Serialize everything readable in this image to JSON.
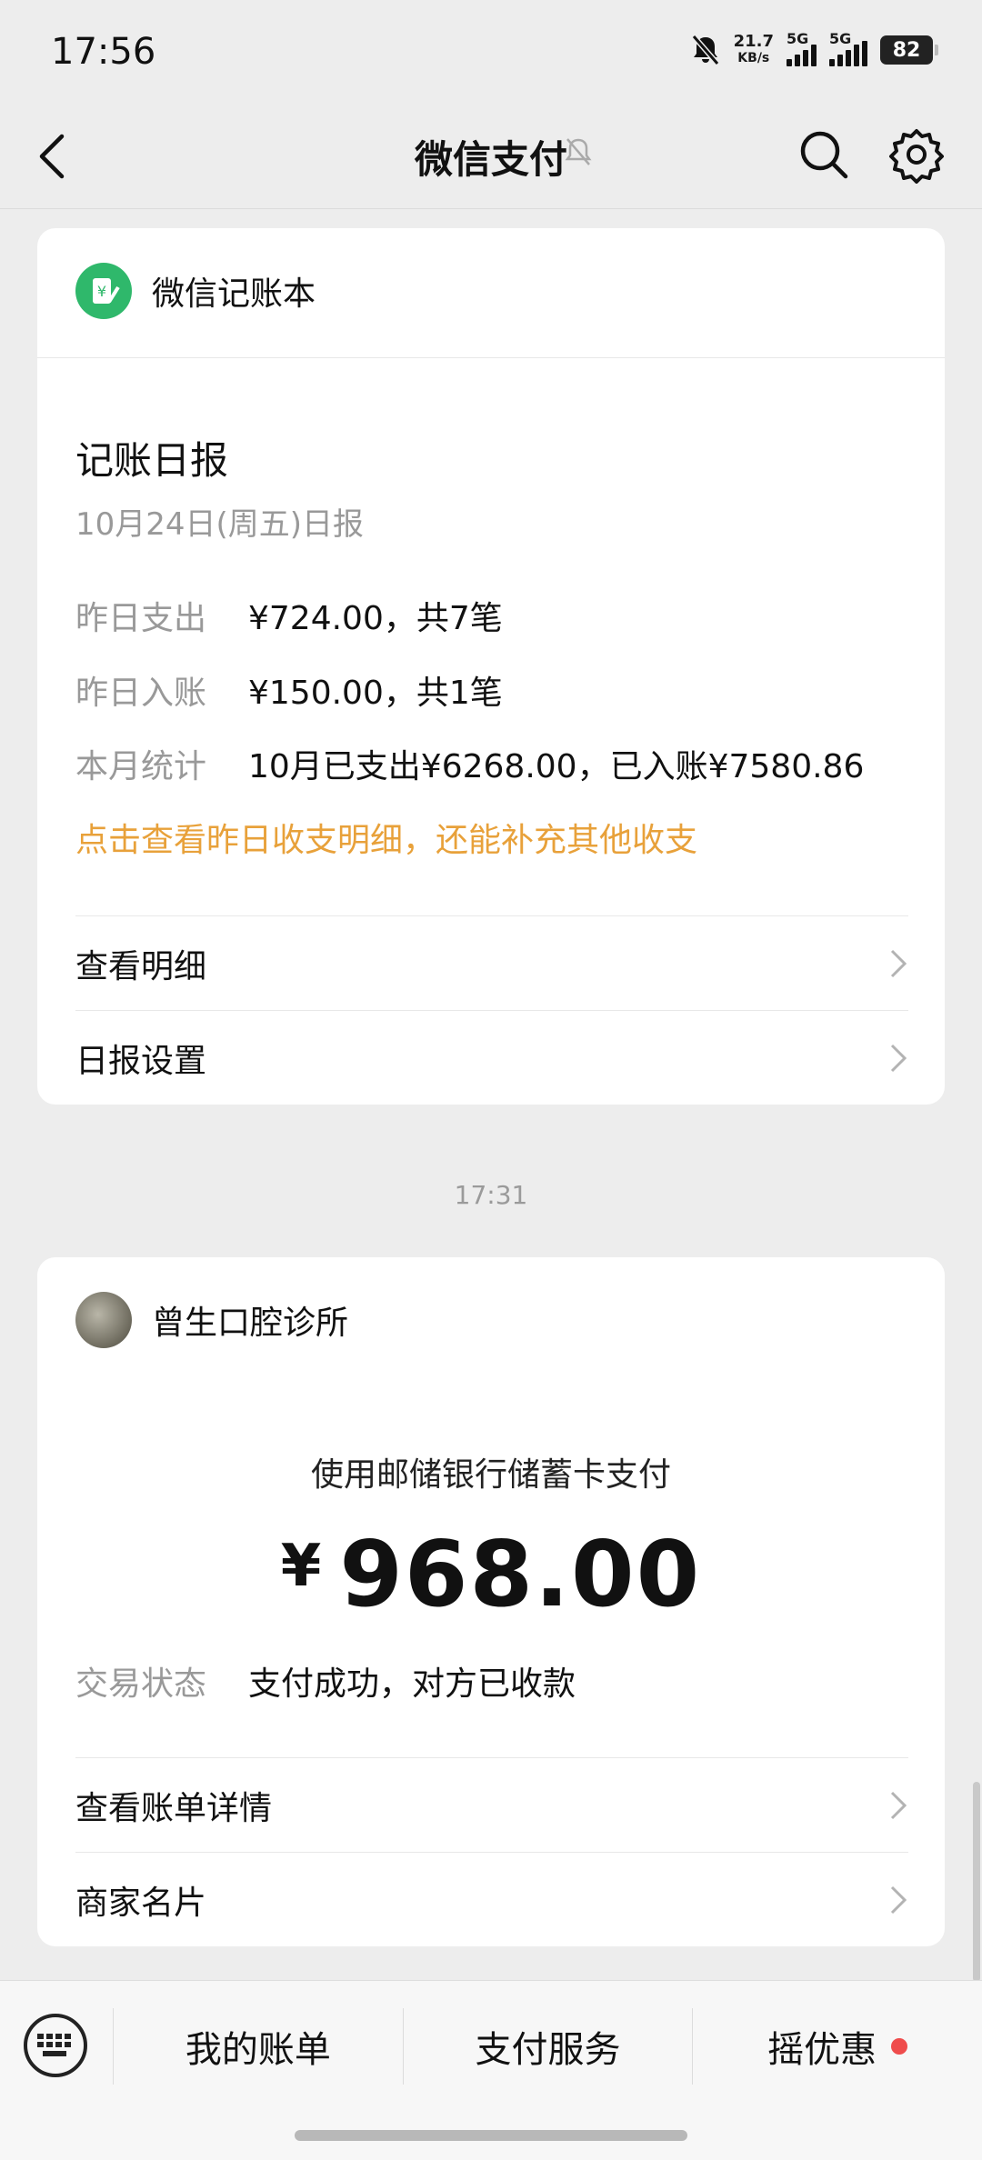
{
  "status_bar": {
    "time": "17:56",
    "net_speed_value": "21.7",
    "net_speed_unit": "KB/s",
    "sim1": "5G",
    "sim2": "5G",
    "battery": "82"
  },
  "nav": {
    "title": "微信支付"
  },
  "ledger_card": {
    "header": "微信记账本",
    "title": "记账日报",
    "date": "10月24日(周五)日报",
    "rows": [
      {
        "label": "昨日支出",
        "value": "¥724.00，共7笔"
      },
      {
        "label": "昨日入账",
        "value": "¥150.00，共1笔"
      },
      {
        "label": "本月统计",
        "value": "10月已支出¥6268.00，已入账¥7580.86"
      }
    ],
    "hint_link": "点击查看昨日收支明细，还能补充其他收支",
    "actions": [
      "查看明细",
      "日报设置"
    ]
  },
  "timestamp": "17:31",
  "payment_card": {
    "merchant": "曾生口腔诊所",
    "pay_method": "使用邮储银行储蓄卡支付",
    "currency": "¥",
    "amount": "968.00",
    "status_label": "交易状态",
    "status_value": "支付成功，对方已收款",
    "actions": [
      "查看账单详情",
      "商家名片"
    ]
  },
  "bottom_bar": {
    "tabs": [
      "我的账单",
      "支付服务",
      "摇优惠"
    ]
  },
  "colors": {
    "accent_orange": "#e8a13a",
    "wechat_green": "#2fb86b",
    "badge_red": "#ef4c4c"
  }
}
